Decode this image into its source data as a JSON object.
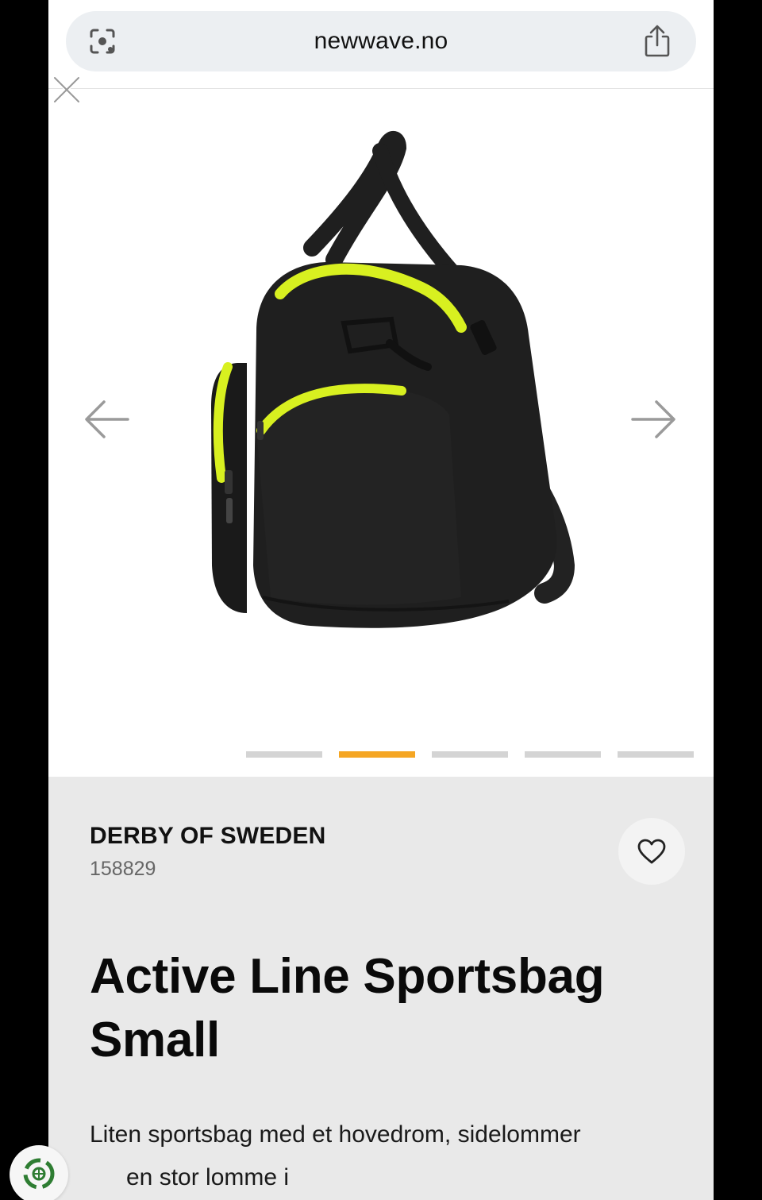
{
  "browser": {
    "url": "newwave.no",
    "icons": [
      "lens-icon",
      "share-icon",
      "close-icon"
    ]
  },
  "gallery": {
    "image_alt": "Active Line Sportsbag Small - black bag with lime green zippers",
    "slide_count": 5,
    "active_slide": 2,
    "accent_color": "#f5a623",
    "prev_icon": "arrow-left-icon",
    "next_icon": "arrow-right-icon"
  },
  "product": {
    "brand": "DERBY OF SWEDEN",
    "sku": "158829",
    "title": "Active Line Sportsbag Small",
    "description_line1": "Liten sportsbag med et hovedrom, sidelommer",
    "description_line2": "en stor lomme i",
    "favorite_icon": "heart-icon"
  },
  "colors": {
    "bag": "#1f1f1f",
    "zipper": "#d8f020",
    "panel": "#e9e9e9"
  }
}
